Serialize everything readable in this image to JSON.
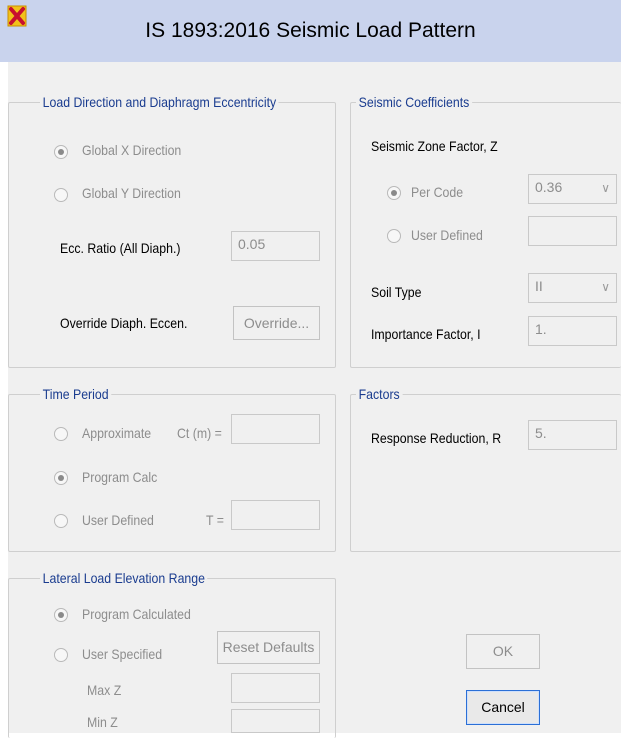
{
  "window": {
    "title": "IS 1893:2016 Seismic Load Pattern",
    "icon": "app-x-icon"
  },
  "load_direction": {
    "legend": "Load Direction and Diaphragm Eccentricity",
    "global_x": "Global  X  Direction",
    "global_y": "Global  Y  Direction",
    "selected": "global_x",
    "ecc_label": "Ecc. Ratio (All Diaph.)",
    "ecc_value": "0.05",
    "override_label": "Override Diaph. Eccen.",
    "override_button": "Override..."
  },
  "seismic_coefficients": {
    "legend": "Seismic Coefficients",
    "zone_label": "Seismic Zone Factor, Z",
    "per_code": "Per Code",
    "per_code_value": "0.36",
    "user_defined": "User Defined",
    "user_defined_value": "",
    "selected": "per_code",
    "soil_label": "Soil Type",
    "soil_value": "II",
    "importance_label": "Importance Factor, I",
    "importance_value": "1."
  },
  "time_period": {
    "legend": "Time Period",
    "approximate": "Approximate",
    "ct_label": "Ct (m) =",
    "ct_value": "",
    "program_calc": "Program Calc",
    "user_defined": "User Defined",
    "t_label": "T =",
    "t_value": "",
    "selected": "program_calc"
  },
  "factors": {
    "legend": "Factors",
    "response_label": "Response Reduction, R",
    "response_value": "5."
  },
  "elevation": {
    "legend": "Lateral Load Elevation Range",
    "program_calculated": "Program Calculated",
    "user_specified": "User Specified",
    "reset_button": "Reset Defaults",
    "max_label": "Max Z",
    "max_value": "",
    "min_label": "Min Z",
    "min_value": "",
    "selected": "program_calculated"
  },
  "buttons": {
    "ok": "OK",
    "cancel": "Cancel"
  }
}
